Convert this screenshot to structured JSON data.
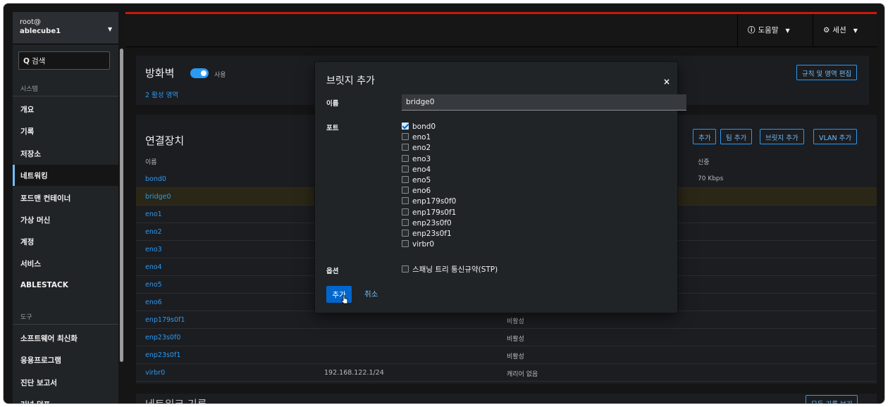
{
  "sidebar": {
    "host_user": "root@",
    "host_name": "ablecube1",
    "search": "검색",
    "section_system": "시스템",
    "items": [
      "개요",
      "기록",
      "저장소",
      "네트워킹",
      "포드맨 컨테이너",
      "가상 머신",
      "계정",
      "서비스",
      "ABLESTACK"
    ],
    "active_index": 3,
    "section_tools": "도구",
    "tools": [
      "소프트웨어 최신화",
      "응용프로그램",
      "진단 보고서",
      "커널 덤프"
    ]
  },
  "header": {
    "help": "도움말",
    "session": "세션"
  },
  "firewall": {
    "title": "방화벽",
    "enabled_label": "사용",
    "zones": "2 활성 영역",
    "edit_button": "규칙 및 영역 편집"
  },
  "interfaces": {
    "title": "연결장치",
    "buttons": [
      "추가",
      "팀 추가",
      "브릿지 추가",
      "VLAN 추가"
    ],
    "col_name": "이름",
    "col_receiving": "신중",
    "rows": [
      {
        "name": "bond0",
        "ip": "",
        "status": "",
        "rate": "70 Kbps"
      },
      {
        "name": "bridge0",
        "ip": "",
        "status": "",
        "rate": ""
      },
      {
        "name": "eno1",
        "ip": "",
        "status": "",
        "rate": ""
      },
      {
        "name": "eno2",
        "ip": "",
        "status": "",
        "rate": ""
      },
      {
        "name": "eno3",
        "ip": "",
        "status": "",
        "rate": ""
      },
      {
        "name": "eno4",
        "ip": "",
        "status": "",
        "rate": ""
      },
      {
        "name": "eno5",
        "ip": "",
        "status": "",
        "rate": ""
      },
      {
        "name": "eno6",
        "ip": "",
        "status": "",
        "rate": ""
      },
      {
        "name": "enp179s0f1",
        "ip": "",
        "status": "비활성",
        "rate": ""
      },
      {
        "name": "enp23s0f0",
        "ip": "",
        "status": "비활성",
        "rate": ""
      },
      {
        "name": "enp23s0f1",
        "ip": "",
        "status": "비활성",
        "rate": ""
      },
      {
        "name": "virbr0",
        "ip": "192.168.122.1/24",
        "status": "캐리어 없음",
        "rate": ""
      }
    ]
  },
  "network_log": {
    "title": "네트워크 기록",
    "button": "모든 기록 보기"
  },
  "modal": {
    "title": "브릿지 추가",
    "close": "×",
    "name_label": "이름",
    "name_value": "bridge0",
    "ports_label": "포트",
    "ports": [
      {
        "name": "bond0",
        "checked": true
      },
      {
        "name": "eno1",
        "checked": false
      },
      {
        "name": "eno2",
        "checked": false
      },
      {
        "name": "eno3",
        "checked": false
      },
      {
        "name": "eno4",
        "checked": false
      },
      {
        "name": "eno5",
        "checked": false
      },
      {
        "name": "eno6",
        "checked": false
      },
      {
        "name": "enp179s0f0",
        "checked": false
      },
      {
        "name": "enp179s0f1",
        "checked": false
      },
      {
        "name": "enp23s0f0",
        "checked": false
      },
      {
        "name": "enp23s0f1",
        "checked": false
      },
      {
        "name": "virbr0",
        "checked": false
      }
    ],
    "options_label": "옵션",
    "stp_label": "스패닝 트리 통신규약(STP)",
    "stp_checked": false,
    "add_button": "추가",
    "cancel_button": "취소"
  },
  "colors": {
    "accent": "#2b9af3",
    "primary_button": "#0066cc",
    "header_stripe": "#c9190b",
    "selected_row": "#2a2716"
  }
}
